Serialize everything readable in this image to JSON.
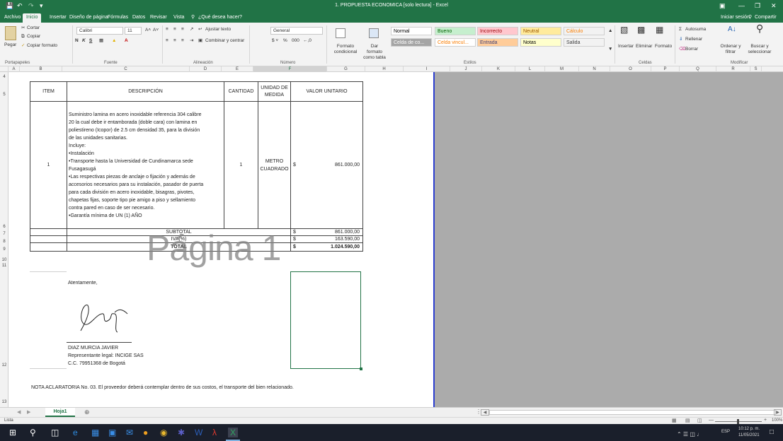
{
  "window": {
    "title": "1. PROPUESTA ECONOMICA  [solo lectura]  - Excel"
  },
  "menu": {
    "items": [
      "Archivo",
      "Inicio",
      "Insertar",
      "Diseño de página",
      "Fórmulas",
      "Datos",
      "Revisar",
      "Vista"
    ],
    "tell_me": "¿Qué desea hacer?",
    "signin": "Iniciar sesión",
    "share": "Compartir"
  },
  "ribbon": {
    "clipboard": {
      "paste": "Pegar",
      "cut": "Cortar",
      "copy": "Copiar",
      "format_painter": "Copiar formato",
      "label": "Portapapeles"
    },
    "font": {
      "name": "Calibri",
      "size": "11",
      "label": "Fuente"
    },
    "alignment": {
      "wrap": "Ajustar texto",
      "merge": "Combinar y centrar",
      "label": "Alineación"
    },
    "number": {
      "format": "General",
      "label": "Número"
    },
    "styles": {
      "cond": "Formato condicional",
      "table": "Dar formato como tabla",
      "cells": [
        {
          "text": "Normal",
          "bg": "#ffffff",
          "fg": "#000000"
        },
        {
          "text": "Bueno",
          "bg": "#c6efce",
          "fg": "#006100"
        },
        {
          "text": "Incorrecto",
          "bg": "#ffc7ce",
          "fg": "#9c0006"
        },
        {
          "text": "Neutral",
          "bg": "#ffeb9c",
          "fg": "#9c5700"
        },
        {
          "text": "Cálculo",
          "bg": "#f2f2f2",
          "fg": "#fa7d00"
        },
        {
          "text": "Celda de co...",
          "bg": "#a5a5a5",
          "fg": "#ffffff"
        },
        {
          "text": "Celda vincul...",
          "bg": "#ffffff",
          "fg": "#fa7d00"
        },
        {
          "text": "Entrada",
          "bg": "#ffcc99",
          "fg": "#3f3f76"
        },
        {
          "text": "Notas",
          "bg": "#ffffcc",
          "fg": "#000000"
        },
        {
          "text": "Salida",
          "bg": "#f2f2f2",
          "fg": "#3f3f3f"
        }
      ],
      "label": "Estilos"
    },
    "cells": {
      "insert": "Insertar",
      "delete": "Eliminar",
      "format": "Formato",
      "label": "Celdas"
    },
    "editing": {
      "autosum": "Autosuma",
      "fill": "Rellenar",
      "clear": "Borrar",
      "sort": "Ordenar y filtrar",
      "find": "Buscar y seleccionar",
      "label": "Modificar"
    }
  },
  "columns": [
    "A",
    "B",
    "C",
    "D",
    "E",
    "F",
    "G",
    "H",
    "I",
    "J",
    "K",
    "L",
    "M",
    "N",
    "O",
    "P",
    "Q",
    "R",
    "S"
  ],
  "rows": [
    "4",
    "5",
    "6",
    "7",
    "8",
    "9",
    "10",
    "11",
    "12",
    "13"
  ],
  "quote": {
    "h_item": "ITEM",
    "h_desc": "DESCRIPCIÓN",
    "h_qty": "CANTIDAD",
    "h_unit": "UNIDAD DE MEDIDA",
    "h_value": "VALOR UNITARIO",
    "item": "1",
    "desc_lines": [
      "Suministro lamina en acero inoxidable referencia 304 calibre",
      "20 la cual debe ir entamborada (doble cara) con lamina en",
      "poliestireno (Icopor) de 2.5 cm densidad 35, para la división",
      "de las unidades sanitarias.",
      "Incluye:",
      "•Instalación",
      "•Transporte hasta la Universidad de Cundinamarca sede",
      "Fusagasugá",
      "•Las respectivas piezas de anclaje o fijación y además de",
      "accesorios necesarios para su instalación, pasador de puerta",
      "para cada división en acero inoxidable, bisagras, pivotes,",
      "chapetas fijas, soporte tipo pie amigo a piso y sellamiento",
      "contra pared en caso de ser necesario.",
      "•Garantía mínima de UN (1) AÑO"
    ],
    "qty": "1",
    "unit_l1": "METRO",
    "unit_l2": "CUADRADO",
    "currency": "$",
    "value": "861.000,00",
    "subtotal_label": "SUBTOTAL",
    "subtotal": "861.000,00",
    "iva_label": "IVA(%)",
    "iva": "163.590,00",
    "total_label": "TOTAL",
    "total": "1.024.590,00"
  },
  "watermark": "Página 1",
  "sign": {
    "greeting": "Atentamente,",
    "name": "DIAZ MURCIA JAVIER",
    "role": "Representante legal: INCIGE SAS",
    "id": "C.C. 79951368 de Bogotá"
  },
  "note": "NOTA ACLARATORIA No. 03. El proveedor deberá contemplar dentro de sus costos, el transporte del bien relacionado.",
  "sheet_tab": "Hoja1",
  "status": {
    "ready": "Lista",
    "zoom": "100%"
  },
  "taskbar": {
    "lang": "ESP",
    "time": "10:12 p. m.",
    "date": "11/05/2021"
  }
}
